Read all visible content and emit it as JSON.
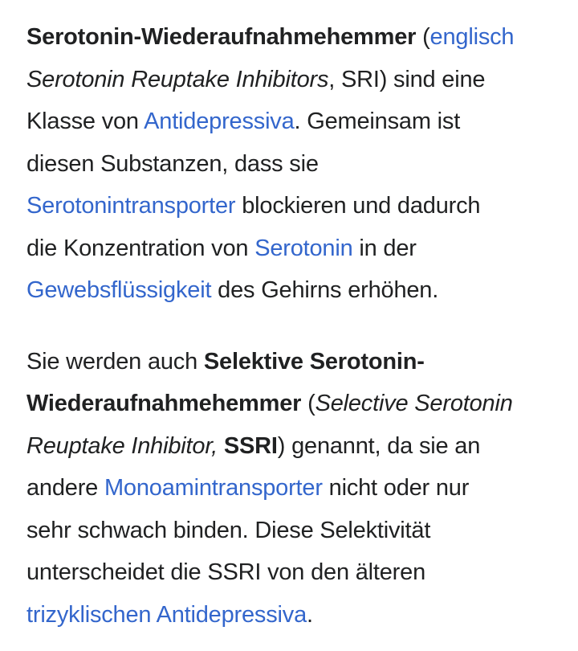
{
  "para1": {
    "term": "Serotonin-Wiederaufnahmehemmer",
    "open_paren": " (",
    "lang_link": "englisch",
    "en_name": "Serotonin Reuptake Inhibitors",
    "abbr_part": ", SRI) sind eine",
    "t3a": "Klasse von ",
    "link_antidepressiva": "Antidepressiva",
    "t3b": ". Gemeinsam ist",
    "t4": "diesen Substanzen, dass sie",
    "link_serotonintransporter": "Serotonintransporter",
    "t5": " blockieren und dadurch",
    "t6a": "die Konzentration von ",
    "link_serotonin": "Serotonin",
    "t6b": " in der",
    "link_gewebsfluessigkeit": "Gewebsflüssigkeit",
    "t7": " des Gehirns erhöhen."
  },
  "para2": {
    "t1a": "Sie werden auch ",
    "term_a": "Selektive Serotonin-",
    "term_b": "Wiederaufnahmehemmer",
    "open_paren": " (",
    "en_name_a": "Selective Serotonin",
    "en_name_b": "Reuptake Inhibitor, ",
    "abbr": "SSRI",
    "t3": ") genannt, da sie an",
    "t4a": "andere ",
    "link_monoamintransporter": "Monoamintransporter",
    "t4b": " nicht oder nur",
    "t5": "sehr schwach binden. Diese Selektivität",
    "t6": "unterscheidet die SSRI von den älteren",
    "link_trizyklische": "trizyklischen Antidepressiva",
    "t7": "."
  },
  "colors": {
    "text": "#202122",
    "link": "#3366cc",
    "background": "#ffffff"
  }
}
